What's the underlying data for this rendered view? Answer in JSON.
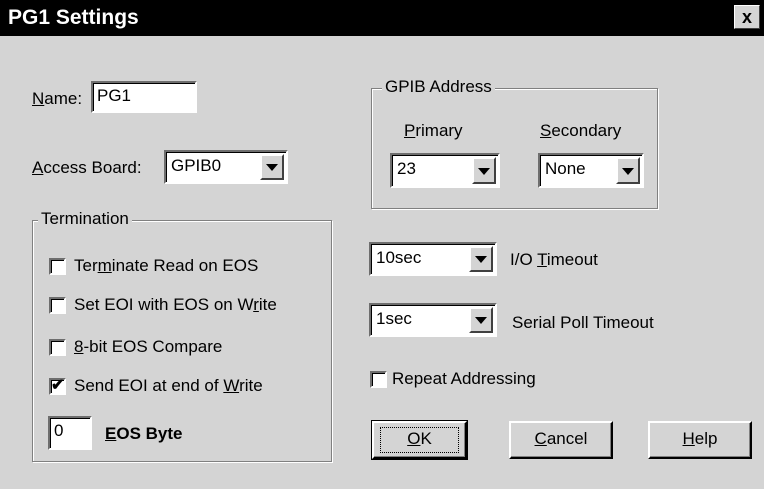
{
  "window": {
    "title": "PG1 Settings",
    "close_label": "x"
  },
  "name": {
    "label_u": "N",
    "label_rest": "ame:",
    "value": "PG1"
  },
  "access_board": {
    "label_u": "A",
    "label_rest": "ccess Board:",
    "value": "GPIB0"
  },
  "gpib_address": {
    "legend": "GPIB Address",
    "primary": {
      "label_u": "P",
      "label_rest": "rimary",
      "value": "23"
    },
    "secondary": {
      "label_u": "S",
      "label_rest": "econdary",
      "value": "None"
    }
  },
  "termination": {
    "legend": "Termination",
    "options": [
      {
        "pre": "Ter",
        "u": "m",
        "post": "inate Read on EOS",
        "checked": false
      },
      {
        "pre": "Set EOI with EOS on W",
        "u": "r",
        "post": "ite",
        "checked": false
      },
      {
        "pre": "",
        "u": "8",
        "post": "-bit EOS Compare",
        "checked": false
      },
      {
        "pre": "Send EOI at end of ",
        "u": "W",
        "post": "rite",
        "checked": true
      }
    ],
    "eos_byte": {
      "value": "0",
      "label_u": "E",
      "label_rest": "OS Byte"
    }
  },
  "io_timeout": {
    "value": "10sec",
    "label_pre": "I/O ",
    "label_u": "T",
    "label_post": "imeout"
  },
  "serial_poll_timeout": {
    "value": "1sec",
    "label": "Serial Poll Timeout"
  },
  "repeat_addressing": {
    "label": "Repeat Addressing",
    "checked": false
  },
  "buttons": {
    "ok": {
      "u": "O",
      "rest": "K"
    },
    "cancel": {
      "u": "C",
      "rest": "ancel"
    },
    "help": {
      "u": "H",
      "rest": "elp"
    }
  }
}
